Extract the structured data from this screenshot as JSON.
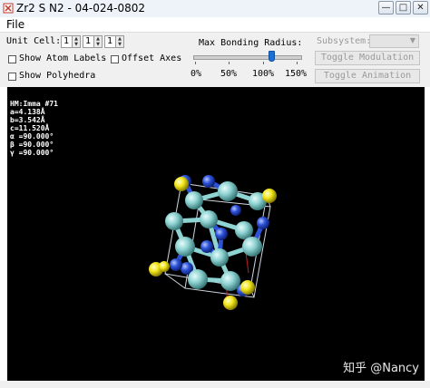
{
  "window": {
    "title": "Zr2 S N2 - 04-024-0802",
    "minimize_icon": "minimize-icon",
    "restore_icon": "restore-icon",
    "close_icon": "close-icon"
  },
  "menu": {
    "file": "File"
  },
  "controls": {
    "unit_cell_label": "Unit Cell:",
    "unit_cell_values": [
      "1",
      "1",
      "1"
    ],
    "show_atom_labels": "Show Atom Labels",
    "offset_axes": "Offset Axes",
    "show_polyhedra": "Show Polyhedra",
    "max_bonding_radius_label": "Max Bonding Radius:",
    "slider_value_percent": 113,
    "slider_ticks": [
      "0%",
      "50%",
      "100%",
      "150%"
    ],
    "subsystem_label": "Subsystem:",
    "toggle_modulation": "Toggle Modulation",
    "toggle_animation": "Toggle Animation"
  },
  "structure_info": [
    "HM:Imma #71",
    "a=4.138Å",
    "b=3.542Å",
    "c=11.520Å",
    "α =90.000°",
    "β =90.000°",
    "γ =90.000°"
  ],
  "watermark": "知乎 @Nancy",
  "colors": {
    "zirconium": "#8fd3d2",
    "sulfur": "#f2e61a",
    "nitrogen": "#2c52d8",
    "background": "#000000",
    "slider_thumb": "#1d6fd6"
  }
}
